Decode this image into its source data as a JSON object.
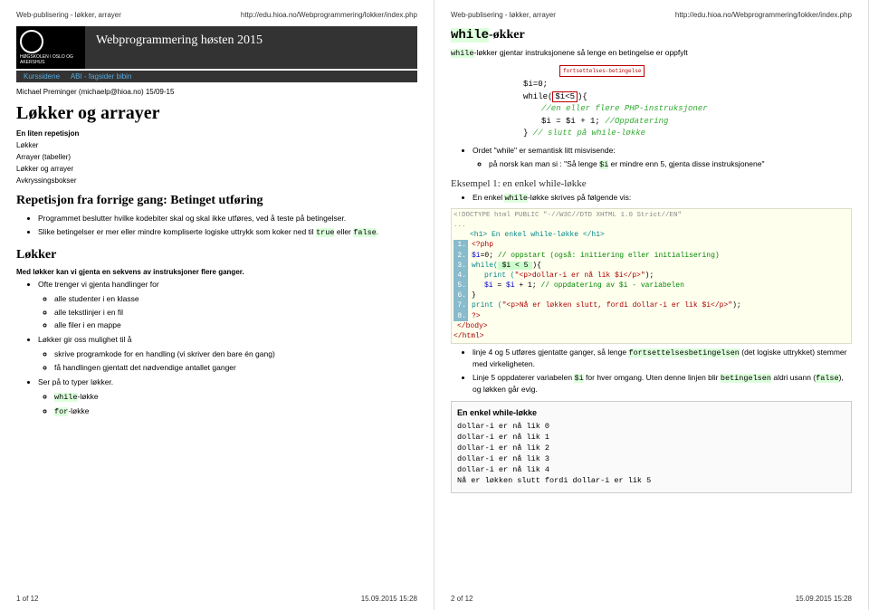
{
  "hdr_title": "Web-publisering - løkker, arrayer",
  "hdr_url": "http://edu.hioa.no/Webprogrammering/lokker/index.php",
  "logo_text": "HØGSKOLEN I OSLO OG AKERSHUS",
  "banner_title": "Webprogrammering høsten 2015",
  "nav": {
    "a": "Kurssidene",
    "b": "ABI - fagsider bibin"
  },
  "byline": "Michael Preminger (michaelp@hioa.no) 15/09-15",
  "p1": {
    "h1": "Løkker og arrayer",
    "sub": "En liten repetisjon",
    "links": {
      "a": "Løkker",
      "b": "Arrayer (tabeller)",
      "c": "Løkker og arrayer",
      "d": "Avkryssingsbokser"
    },
    "h2a": "Repetisjon fra forrige gang: Betinget utføring",
    "li1": "Programmet beslutter hvilke kodebiter skal og skal ikke utføres, ved å teste på betingelser.",
    "li2a": "Slike betingelser er mer eller mindre kompliserte logiske uttrykk som koker ned til ",
    "li2b": "true",
    "li2c": " eller ",
    "li2d": "false",
    "li2e": ".",
    "h2b": "Løkker",
    "sub2": "Med løkker kan vi gjenta en sekvens av instruksjoner flere ganger.",
    "li3": "Ofte trenger vi gjenta handlinger for",
    "li3a": "alle studenter i en klasse",
    "li3b": "alle tekstlinjer i en fil",
    "li3c": "alle filer i en mappe",
    "li4": "Løkker gir oss mulighet til å",
    "li4a": "skrive programkode for en handling (vi skriver den bare én gang)",
    "li4b": "få handlingen gjentatt det nødvendige antallet ganger",
    "li5": "Ser på to typer løkker.",
    "li5a": "while",
    "li5a2": "-løkke",
    "li5b": "for",
    "li5b2": "-løkke",
    "fnum": "1 of 12",
    "fdate": "15.09.2015 15:28"
  },
  "p2": {
    "h2": "while",
    "h2b": "-økker",
    "intro_a": "while",
    "intro_b": "-løkker gjentar instruksjonene så lenge en betingelse er oppfylt",
    "label": "fortsettelses-betingelse",
    "w1": "$i=0;",
    "w2a": "while(",
    "w2b": "$i<5",
    "w2c": "){",
    "w3": "//en eller flere PHP-instruksjoner",
    "w4a": "$i = $i + 1;",
    "w4b": " //Oppdatering",
    "w5a": "}",
    "w5b": " // slutt på while-løkke",
    "li1": "Ordet \"while\" er semantisk litt misvisende:",
    "li1a_a": "på norsk kan man si : \"Så lenge ",
    "li1a_b": "$i",
    "li1a_c": " er mindre enn 5, gjenta disse instruksjonene\"",
    "ex_title": "Eksempel 1: en enkel while-løkke",
    "li2a": "En enkel ",
    "li2b": "while",
    "li2c": "-løkke skrives på følgende vis:",
    "doctype": "<!DOCTYPE html PUBLIC \"-//W3C//DTD XHTML 1.0 Strict//EN\"",
    "dots": "...",
    "c0": "<h1> En enkel while-løkke </h1>",
    "c1": "<?php",
    "c2a": "$i",
    "c2b": "=0;",
    "c2c": "// oppstart (også: initiering eller initialisering)",
    "c3a": "while(",
    "c3b": " $i < 5 ",
    "c3c": "){",
    "c4a": "print (",
    "c4b": "\"<p>dollar-i er nå lik $i</p>\"",
    "c4c": ");",
    "c5a": "$i",
    "c5b": " = ",
    "c5c": "$i",
    "c5d": " + 1;",
    "c5e": "// oppdatering av $i - variabelen",
    "c6": "}",
    "c7a": "print (",
    "c7b": "\"<p>Nå er løkken slutt, fordi dollar-i er lik $i</p>\"",
    "c7c": ");",
    "c8": "?>",
    "c9": "</body>",
    "c10": "</html>",
    "li3a": "linje 4 og 5 utføres gjentatte ganger, så lenge ",
    "li3b": "fortsettelsesbetingelsen",
    "li3c": " (det logiske uttrykket) stemmer med virkeligheten.",
    "li4a": "Linje 5 oppdaterer variabelen ",
    "li4b": "$i",
    "li4c": " for hver omgang. Uten denne linjen blir ",
    "li4d": "betingelsen",
    "li4e": " aldri usann (",
    "li4f": "false",
    "li4g": "), og løkken går evig.",
    "out_title": "En enkel while-løkke",
    "out1": "dollar-i er nå lik 0",
    "out2": "dollar-i er nå lik 1",
    "out3": "dollar-i er nå lik 2",
    "out4": "dollar-i er nå lik 3",
    "out5": "dollar-i er nå lik 4",
    "out6": "Nå er løkken slutt fordi dollar-i er lik 5",
    "fnum": "2 of 12",
    "fdate": "15.09.2015 15:28"
  }
}
